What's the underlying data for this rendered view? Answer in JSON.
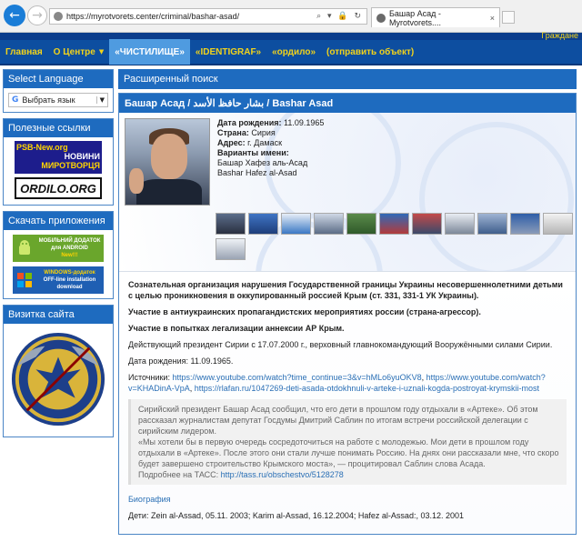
{
  "browser": {
    "url": "https://myrotvorets.center/criminal/bashar-asad/",
    "tab_title": "Башар Асад - Myrotvorets....",
    "url_controls": "⌕ ▾ 🔒 ↻",
    "tab_close": "×"
  },
  "site": {
    "topbar_right": "Граждане",
    "menu": [
      {
        "label": "Главная"
      },
      {
        "label": "О Центре",
        "caret": "▼"
      },
      {
        "label": "«ЧИСТИЛИЩЕ»"
      },
      {
        "label": "«IDENTIGRAF»"
      },
      {
        "label": "«ордило»"
      },
      {
        "label": "(отправить объект)"
      }
    ]
  },
  "sidebar": {
    "language": {
      "title": "Select Language",
      "select_label": "Выбрать язык",
      "g": "G",
      "arrow": "▼"
    },
    "links": {
      "title": "Полезные ссылки",
      "psb": {
        "line1": "PSB-New.org",
        "line2": "НОВИНИ",
        "line3": "МИРОТВОРЦЯ"
      },
      "ordilo": "ORDILO.ORG"
    },
    "apps": {
      "title": "Скачать приложения",
      "android": [
        "МОБІЛЬНИЙ ДОДАТОК",
        "для ANDROID",
        "New!!!"
      ],
      "windows": [
        "WINDOWS-додаток",
        "OFF-line installation",
        "download"
      ]
    },
    "card": {
      "title": "Визитка сайта",
      "emblem_text": "AQUILA NON CAPTAT MUSCAS"
    }
  },
  "main": {
    "search_title": "Расширенный поиск",
    "person": {
      "header": "Башар Асад / بشار حافظ الأسد / Bashar Asad",
      "info": {
        "dob_label": "Дата рождения:",
        "dob": "11.09.1965",
        "country_label": "Страна:",
        "country": "Сирия",
        "address_label": "Адрес:",
        "address": "г. Дамаск",
        "variants_label": "Варианты имени:",
        "variant1": "Башар Хафез аль-Асад",
        "variant2": "Bashar Hafez al-Asad"
      },
      "watermark_text": "МИРОТВОРЕЦ PRO BONO PUBLICO"
    },
    "content": {
      "p1": "Сознательная организация нарушения Государственной границы Украины несовершеннолетними детьми с целью проникновения в оккупированный россией Крым (ст. 331, 331-1 УК Украины).",
      "p2": "Участие в антиукраинских пропагандистских мероприятиях россии (страна-агрессор).",
      "p3": "Участие в попытках легализации аннексии АР Крым.",
      "p4": "Действующий президент Сирии с 17.07.2000 г., верховный главнокомандующий Вооружёнными силами Сирии.",
      "p5": "Дата рождения: 11.09.1965.",
      "sources_label": "Источники:",
      "src1": "https://www.youtube.com/watch?time_continue=3&v=hMLo6yuOKV8",
      "src2": "https://www.youtube.com/watch?v=KHADinA-VpA",
      "src3": "https://rlafan.ru/1047269-deti-asada-otdokhnuli-v-arteke-i-uznali-kogda-postroyat-krymskii-most",
      "quote1": "Сирийский президент Башар Асад сообщил, что его дети в прошлом году отдыхали в «Артеке». Об этом рассказал журналистам депутат Госдумы Дмитрий Саблин по итогам встречи российской делегации с сирийским лидером.",
      "quote2": "«Мы хотели бы в первую очередь сосредоточиться на работе с молодежью. Мои дети в прошлом году отдыхали в «Артеке». После этого они стали лучше понимать Россию. На днях они рассказали мне, что скоро будет завершено строительство Крымского моста», — процитировал Саблин слова Асада.",
      "quote3_label": "Подробнее на ТАСС:",
      "quote3_link": "http://tass.ru/obschestvo/5128278",
      "bio_label": "Биография",
      "children": "Дети: Zein al-Assad, 05.11. 2003; Karim al-Assad, 16.12.2004; Hafez al-Assad:, 03.12. 2001"
    }
  }
}
